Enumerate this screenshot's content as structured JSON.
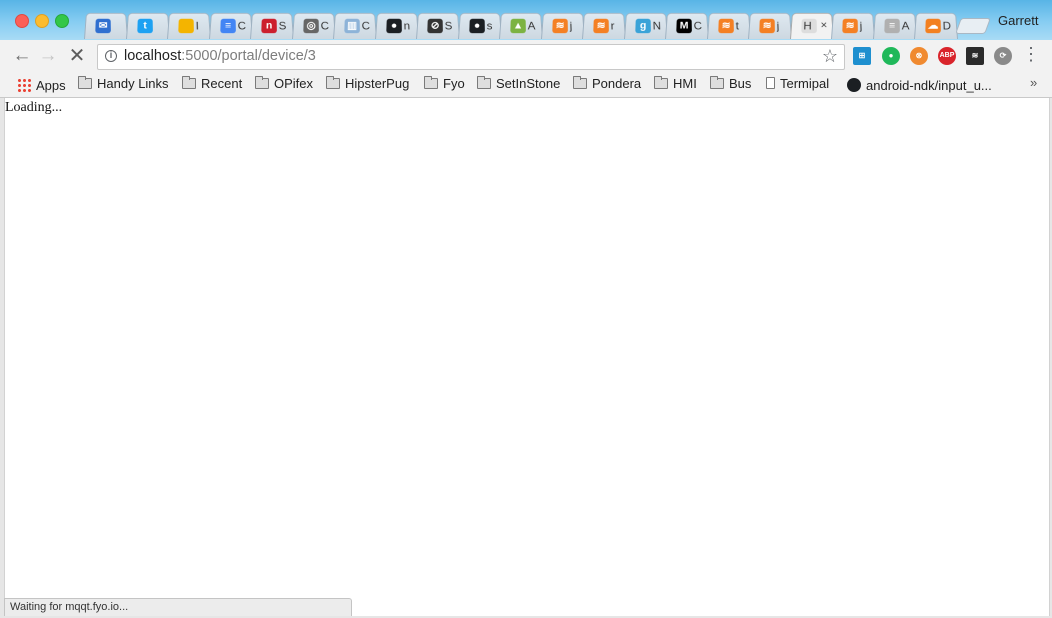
{
  "window": {
    "profile_name": "Garrett"
  },
  "tabs": [
    {
      "icon": "mail-icon",
      "label": "",
      "color": "#2f6fd0",
      "glyph": "✉"
    },
    {
      "icon": "twitter-icon",
      "label": "",
      "color": "#1da1f2",
      "glyph": "t"
    },
    {
      "icon": "slides-icon",
      "label": "I",
      "color": "#f4b400",
      "glyph": ""
    },
    {
      "icon": "docs-icon",
      "label": "C",
      "color": "#4285f4",
      "glyph": "≡"
    },
    {
      "icon": "n-icon",
      "label": "S",
      "color": "#cc1f2d",
      "glyph": "n"
    },
    {
      "icon": "hat-icon",
      "label": "C",
      "color": "#666666",
      "glyph": "◎"
    },
    {
      "icon": "chart-icon",
      "label": "C",
      "color": "#8db3d8",
      "glyph": "▥"
    },
    {
      "icon": "github-icon",
      "label": "n",
      "color": "#1b1f23",
      "glyph": "●"
    },
    {
      "icon": "compass-icon",
      "label": "S",
      "color": "#333333",
      "glyph": "⊘"
    },
    {
      "icon": "github-icon",
      "label": "s",
      "color": "#1b1f23",
      "glyph": "●"
    },
    {
      "icon": "android-icon",
      "label": "A",
      "color": "#7cb342",
      "glyph": "▲"
    },
    {
      "icon": "stackoverflow-icon",
      "label": "j",
      "color": "#f48024",
      "glyph": "≋"
    },
    {
      "icon": "stackoverflow-icon",
      "label": "r",
      "color": "#f48024",
      "glyph": "≋"
    },
    {
      "icon": "g-icon",
      "label": "N",
      "color": "#3aa3d8",
      "glyph": "g"
    },
    {
      "icon": "medium-icon",
      "label": "C",
      "color": "#000000",
      "glyph": "M"
    },
    {
      "icon": "stackoverflow-icon",
      "label": "t",
      "color": "#f48024",
      "glyph": "≋"
    },
    {
      "icon": "stackoverflow-icon",
      "label": "j",
      "color": "#f48024",
      "glyph": "≋"
    },
    {
      "icon": "blank-icon",
      "label": "H",
      "color": "#dddddd",
      "glyph": "",
      "active": true
    },
    {
      "icon": "stackoverflow-icon",
      "label": "j",
      "color": "#f48024",
      "glyph": "≋"
    },
    {
      "icon": "list-icon",
      "label": "A",
      "color": "#b0b0b0",
      "glyph": "≡"
    },
    {
      "icon": "cloudflare-icon",
      "label": "D",
      "color": "#f38020",
      "glyph": "☁"
    }
  ],
  "toolbar": {
    "url_host": "localhost",
    "url_rest": ":5000/portal/device/3"
  },
  "extensions": [
    {
      "name": "ext-blue-icon",
      "glyph": "⊞"
    },
    {
      "name": "ext-green-icon",
      "glyph": "●"
    },
    {
      "name": "ext-orange-icon",
      "glyph": "⊗"
    },
    {
      "name": "adblock-icon",
      "glyph": "ABP"
    },
    {
      "name": "buffer-icon",
      "glyph": "≋"
    },
    {
      "name": "sync-icon",
      "glyph": "⟳"
    }
  ],
  "bookmarks": [
    {
      "label": "Apps",
      "type": "apps"
    },
    {
      "label": "Handy Links",
      "type": "folder"
    },
    {
      "label": "Recent",
      "type": "folder"
    },
    {
      "label": "OPifex",
      "type": "folder"
    },
    {
      "label": "HipsterPug",
      "type": "folder"
    },
    {
      "label": "Fyo",
      "type": "folder"
    },
    {
      "label": "SetInStone",
      "type": "folder"
    },
    {
      "label": "Pondera",
      "type": "folder"
    },
    {
      "label": "HMI",
      "type": "folder"
    },
    {
      "label": "Bus",
      "type": "folder"
    },
    {
      "label": "Termipal",
      "type": "page"
    },
    {
      "label": "android-ndk/input_u...",
      "type": "github"
    }
  ],
  "page": {
    "loading_text": "Loading..."
  },
  "status_bar": {
    "text": "Waiting for mqqt.fyo.io..."
  }
}
